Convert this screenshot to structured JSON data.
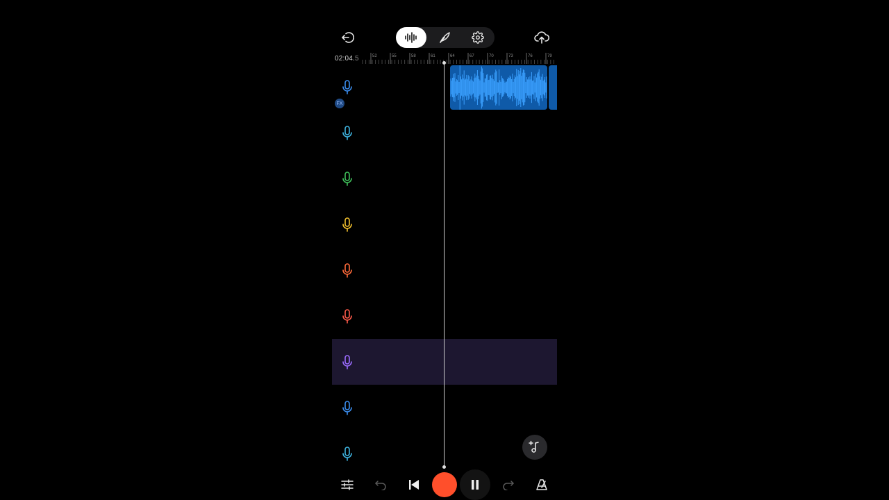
{
  "header": {
    "back_icon": "exit-icon",
    "tabs": [
      {
        "icon": "waveform-icon",
        "active": true
      },
      {
        "icon": "quill-icon",
        "active": false
      },
      {
        "icon": "gear-icon",
        "active": false
      }
    ],
    "upload_icon": "cloud-upload-icon"
  },
  "ruler": {
    "time_main": "02:04.",
    "time_fraction": "5",
    "ticks": [
      "52",
      "55",
      "58",
      "61",
      "64",
      "67",
      "70",
      "73",
      "76",
      "79"
    ]
  },
  "tracks": [
    {
      "mic_color": "#3b8ef0",
      "selected": false,
      "fx_badge": "FX"
    },
    {
      "mic_color": "#3fb4e0",
      "selected": false
    },
    {
      "mic_color": "#3fbf5a",
      "selected": false
    },
    {
      "mic_color": "#f2c02e",
      "selected": false
    },
    {
      "mic_color": "#ff6a3a",
      "selected": false
    },
    {
      "mic_color": "#ff5a4a",
      "selected": false
    },
    {
      "mic_color": "#9b6cff",
      "selected": true
    },
    {
      "mic_color": "#3b8ef0",
      "selected": false
    },
    {
      "mic_color": "#3fb4e0",
      "selected": false
    }
  ],
  "colors": {
    "clip": "#0f5aa8",
    "waveform": "#3aa0ff",
    "record": "#ff4f2b",
    "selected_track": "#1d1730"
  },
  "fab_icon": "add-music-note-icon",
  "bottom": {
    "mixer_icon": "sliders-icon",
    "undo_icon": "undo-icon",
    "skip_start_icon": "skip-to-start-icon",
    "record_icon": "record-icon",
    "pause_icon": "pause-icon",
    "redo_icon": "redo-icon",
    "metronome_icon": "metronome-icon"
  }
}
